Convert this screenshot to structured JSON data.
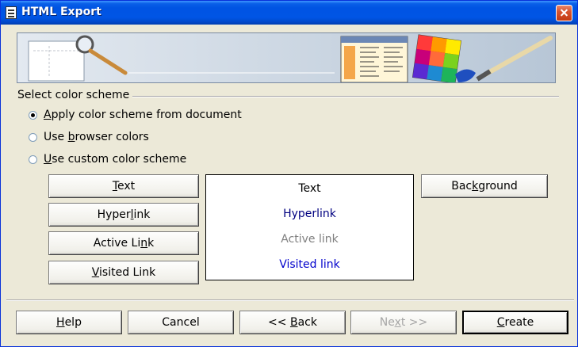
{
  "window": {
    "title": "HTML Export",
    "accent_color": "#0054e3"
  },
  "color_scheme_group": {
    "label": "Select color scheme",
    "options": [
      {
        "pre": "",
        "key": "A",
        "post": "pply color scheme from document",
        "checked": true
      },
      {
        "pre": "Use ",
        "key": "b",
        "post": "rowser colors",
        "checked": false
      },
      {
        "pre": "",
        "key": "U",
        "post": "se custom color scheme",
        "checked": false
      }
    ]
  },
  "color_buttons": {
    "text": {
      "pre": "",
      "key": "T",
      "post": "ext"
    },
    "hyperlink": {
      "pre": "Hyper",
      "key": "l",
      "post": "ink"
    },
    "active_link": {
      "pre": "Active Li",
      "key": "n",
      "post": "k"
    },
    "visited_link": {
      "pre": "",
      "key": "V",
      "post": "isited Link"
    },
    "background": {
      "pre": "Bac",
      "key": "k",
      "post": "ground"
    }
  },
  "preview": {
    "text": {
      "label": "Text",
      "color": "#000000"
    },
    "hyperlink": {
      "label": "Hyperlink",
      "color": "#000080"
    },
    "active_link": {
      "label": "Active link",
      "color": "#808080"
    },
    "visited_link": {
      "label": "Visited link",
      "color": "#0000cc"
    }
  },
  "footer": {
    "help": {
      "pre": "",
      "key": "H",
      "post": "elp"
    },
    "cancel": "Cancel",
    "back": {
      "pre": "<< ",
      "key": "B",
      "post": "ack"
    },
    "next": {
      "pre": "Ne",
      "key": "x",
      "post": "t >>",
      "disabled": true
    },
    "create": {
      "pre": "",
      "key": "C",
      "post": "reate"
    }
  }
}
